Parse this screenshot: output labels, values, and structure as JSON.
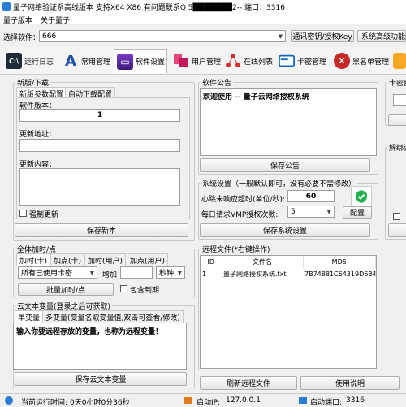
{
  "window": {
    "title": "量子网络验证系高线版本 支持X64 X86 有问题联系Q 5███████2-- 端口：3316"
  },
  "menu": [
    "量子版本",
    "关于量子"
  ],
  "software": {
    "label": "选择软件：",
    "value": "666",
    "btn_comm": "通讯密钥/授权Key",
    "btn_adv": "系统高级功能复"
  },
  "toolbar": [
    {
      "label": "运行日志",
      "icon": "terminal-icon"
    },
    {
      "label": "常用管理",
      "icon": "a-logo-icon"
    },
    {
      "label": "软件设置",
      "icon": "monitor-icon"
    },
    {
      "label": "用户管理",
      "icon": "users-icon"
    },
    {
      "label": "在线列表",
      "icon": "network-icon"
    },
    {
      "label": "卡密管理",
      "icon": "card-icon"
    },
    {
      "label": "黑名单管理",
      "icon": "block-icon"
    }
  ],
  "version": {
    "group": "新版/下载",
    "tab1": "新版参数配置",
    "tab2": "自动下载配置",
    "ver_label": "软件版本：",
    "ver_value": "1",
    "url_label": "更新地址：",
    "url_value": "",
    "content_label": "更新内容：",
    "content_value": "",
    "force_label": "强制更新",
    "save": "保存新本"
  },
  "points": {
    "group": "全体加时/点",
    "tabs": [
      "加时(卡)",
      "加点(卡)",
      "加时(用户)",
      "加点(用户)"
    ],
    "card_select": "所有已使用卡密",
    "add_label": "增加",
    "add_value": "",
    "unit": "秒钟",
    "batch": "批量加时/点",
    "include_expired": "包含到期"
  },
  "cloud": {
    "group": "云文本变量(登录之后可获取)",
    "tab1": "单变量",
    "tab2": "多变量(变量名取变量值,双击可查看/修改)",
    "content": "输入你要远程存放的变量，也称为远程变量！",
    "save": "保存云文本变量"
  },
  "notice": {
    "group": "软件公告",
    "content": "欢迎使用 -- 量子云网络授权系统",
    "save": "保存公告"
  },
  "settings": {
    "group": "系统设置（一般默认即可，没有必要不需修改）",
    "hb_label": "心跳未响应超时(单位/秒):",
    "hb_value": "60",
    "vmp_label": "每日请求VMP授权次数:",
    "vmp_value": "5",
    "config": "配置",
    "save": "保存系统设置"
  },
  "files": {
    "group": "远程文件(*右键操作)",
    "columns": [
      "ID",
      "文件名",
      "MD5"
    ],
    "rows": [
      {
        "id": "1",
        "name": "量子网络授权系统.txt",
        "md5": "7B74881C64319D684AEB..."
      }
    ],
    "refresh": "刷新远程文件",
    "help": "使用说明"
  },
  "right_partial": {
    "card_title": "卡密自",
    "unbind_title": "解绑设"
  },
  "status": {
    "time_label": "当前运行时间:",
    "time_value": "0天0小时0分36秒",
    "ip_label": "启动IP:",
    "ip_value": "127.0.0.1",
    "port_label": "启动端口:",
    "port_value": "3316"
  },
  "colors": {
    "accent": "#2c7bd6",
    "shield": "#22b14c"
  }
}
